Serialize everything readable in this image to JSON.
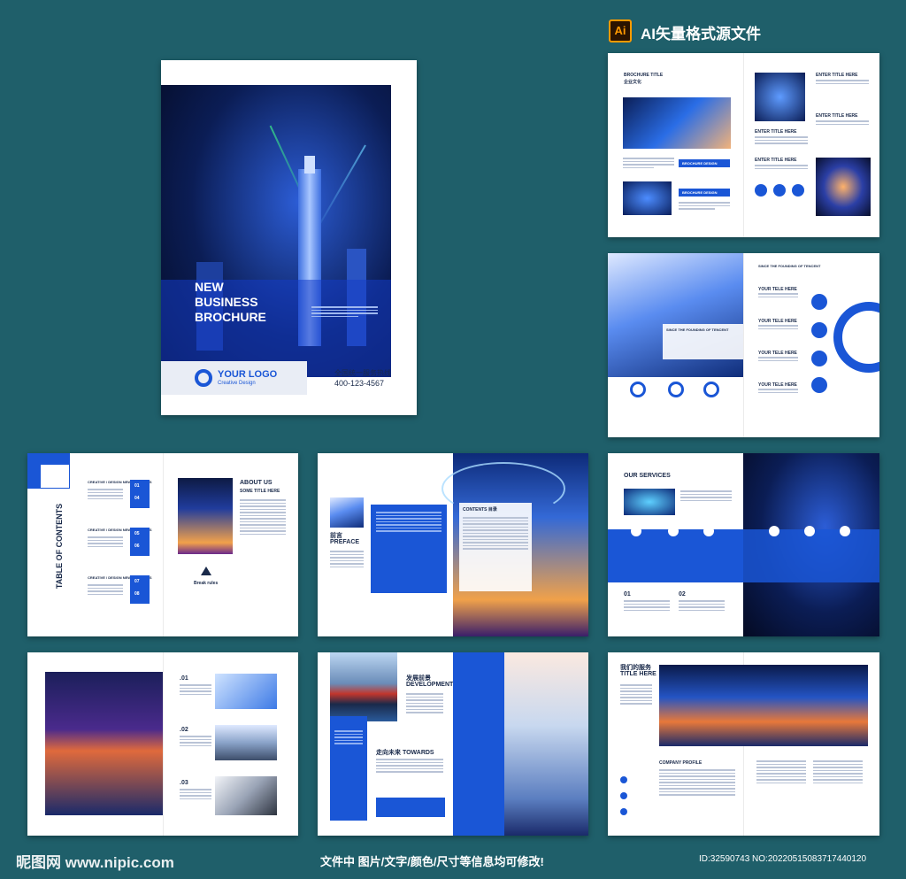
{
  "header": {
    "ai_badge": "Ai",
    "title": "AI矢量格式源文件"
  },
  "cover": {
    "title_lines": [
      "NEW",
      "BUSINESS",
      "BROCHURE"
    ],
    "logo_text": "YOUR LOGO",
    "logo_sub": "Creative Design",
    "hotline_label": "全国统一服务热线",
    "hotline_number": "400-123-4567"
  },
  "spread1": {
    "title": "BROCHURE TITLE",
    "subtitle": "企业文化",
    "btn1": "BROCHURE DESIGN",
    "btn2": "BROCHURE DESIGN",
    "enter_title": "ENTER TITLE HERE"
  },
  "spread2": {
    "since": "SINCE THE FOUNDING OF TENCENT",
    "tele": "YOUR TELE HERE"
  },
  "contents": {
    "title": "TABLE OF CONTENTS",
    "sections": [
      {
        "label": "CREATIVE / DESIGN NEW PRODUCTS",
        "n1": "01",
        "n2": "04"
      },
      {
        "label": "CREATIVE / DESIGN NEW PRODUCTS",
        "n1": "05",
        "n2": "06"
      },
      {
        "label": "CREATIVE / DESIGN NEW PRODUCTS",
        "n1": "07",
        "n2": "08"
      }
    ],
    "about": "ABOUT US",
    "about_sub": "SOME TITLE HERE",
    "break": "Break rules"
  },
  "preface": {
    "cn": "前言",
    "en": "PREFACE",
    "contents": "CONTENTS 目录"
  },
  "services": {
    "title": "OUR SERVICES",
    "n1": "01",
    "n2": "02"
  },
  "gallery": {
    "n1": ".01",
    "n2": ".02",
    "n3": ".03"
  },
  "development": {
    "cn": "发展前景",
    "en": "DEVELOPMENT",
    "towards_cn": "走向未来",
    "towards_en": "TOWARDS"
  },
  "ourservice": {
    "cn": "我们的服务",
    "en": "TITLE HERE",
    "profile": "COMPANY PROFILE"
  },
  "footer": {
    "site": "昵图网 www.nipic.com",
    "note": "文件中 图片/文字/颜色/尺寸等信息均可修改!",
    "id": "ID:32590743 NO:20220515083717440120"
  }
}
